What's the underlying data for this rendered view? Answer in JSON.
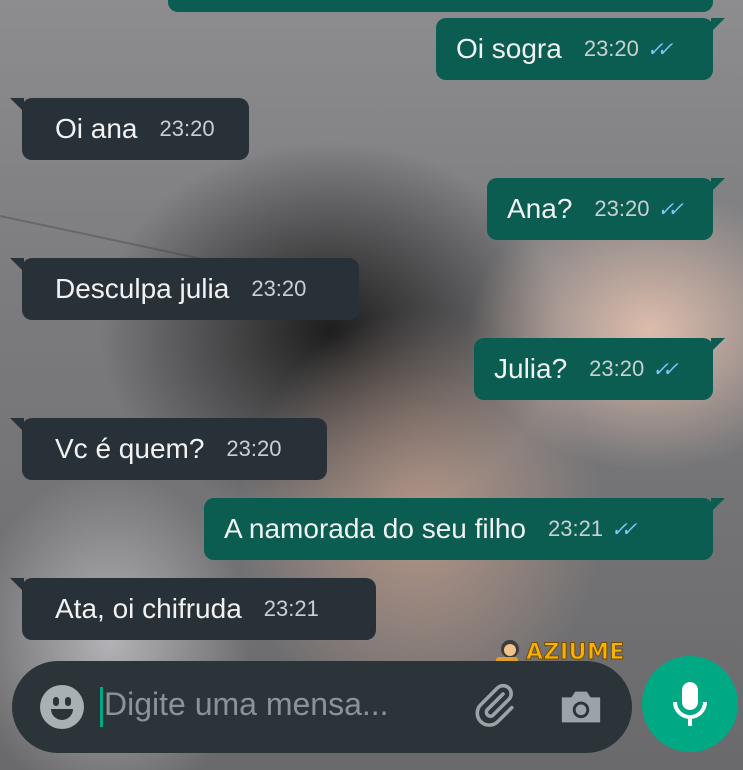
{
  "messages": [
    {
      "direction": "out",
      "text": "Oi sogra",
      "time": "23:20",
      "status": "read"
    },
    {
      "direction": "in",
      "text": "Oi ana",
      "time": "23:20"
    },
    {
      "direction": "out",
      "text": "Ana?",
      "time": "23:20",
      "status": "read"
    },
    {
      "direction": "in",
      "text": "Desculpa julia",
      "time": "23:20"
    },
    {
      "direction": "out",
      "text": "Julia?",
      "time": "23:20",
      "status": "read"
    },
    {
      "direction": "in",
      "text": "Vc é quem?",
      "time": "23:20"
    },
    {
      "direction": "out",
      "text": "A namorada do seu filho",
      "time": "23:21",
      "status": "read"
    },
    {
      "direction": "in",
      "text": "Ata, oi chifruda",
      "time": "23:21"
    }
  ],
  "composer": {
    "placeholder": "Digite uma mensa...",
    "emoji_icon": "emoji-icon",
    "attach_icon": "paperclip-icon",
    "camera_icon": "camera-icon",
    "mic_icon": "microphone-icon"
  },
  "watermark": {
    "text": "AZIUME"
  },
  "colors": {
    "incoming_bubble": "#283137",
    "outgoing_bubble": "#0b5d52",
    "read_ticks": "#7fc4ff",
    "accent": "#00a884"
  }
}
